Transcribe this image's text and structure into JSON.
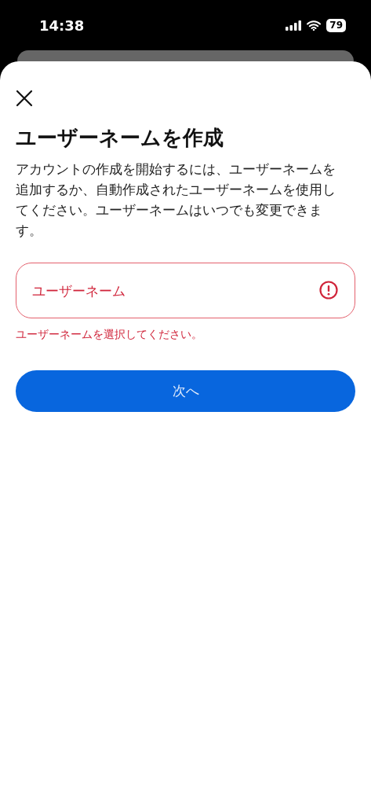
{
  "status_bar": {
    "time": "14:38",
    "battery": "79"
  },
  "sheet": {
    "title": "ユーザーネームを作成",
    "description": "アカウントの作成を開始するには、ユーザーネームを追加するか、自動作成されたユーザーネームを使用してください。ユーザーネームはいつでも変更できます。",
    "username_field": {
      "placeholder": "ユーザーネーム",
      "error": true,
      "error_message": "ユーザーネームを選択してください。"
    },
    "next_button": "次へ"
  }
}
